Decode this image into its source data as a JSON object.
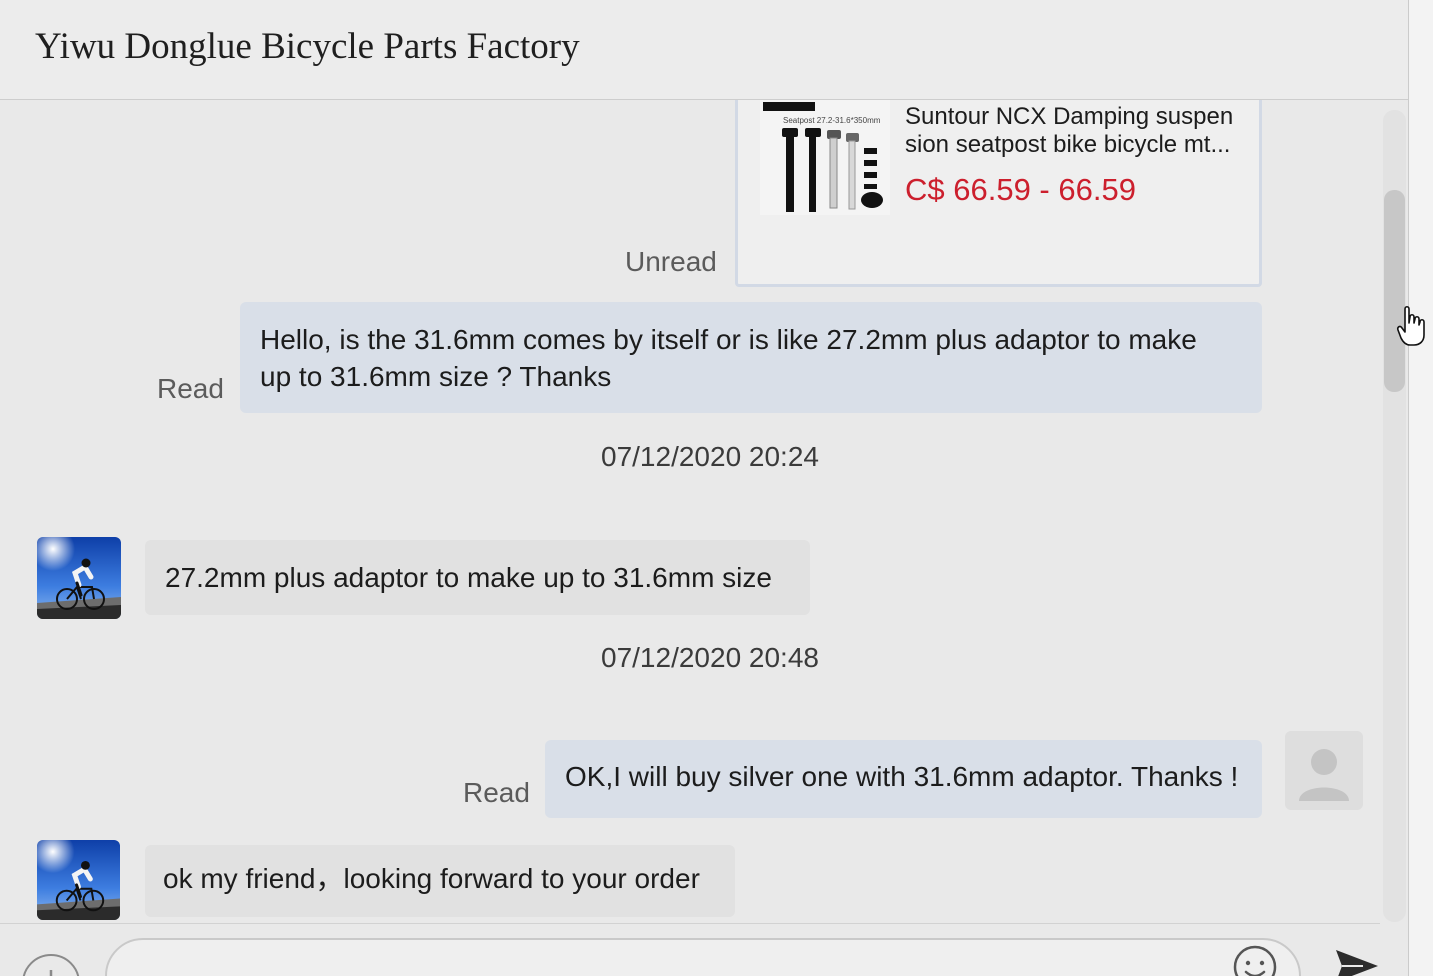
{
  "header": {
    "title": "Yiwu Donglue Bicycle Parts Factory"
  },
  "product_card": {
    "image_caption": "Seatpost 27.2-31.6*350mm",
    "title_lines": [
      "Suntour NCX Damping suspen",
      "sion seatpost bike bicycle mt..."
    ],
    "price": "C$ 66.59 - 66.59",
    "read_status": "Unread"
  },
  "messages": [
    {
      "direction": "outgoing",
      "text": "Hello, is the 31.6mm comes by itself or is like 27.2mm plus adaptor to make up to 31.6mm size ? Thanks",
      "read_status": "Read"
    },
    {
      "type": "timestamp",
      "text": "07/12/2020 20:24"
    },
    {
      "direction": "incoming",
      "text": "27.2mm plus adaptor to make up to 31.6mm size"
    },
    {
      "type": "timestamp",
      "text": "07/12/2020 20:48"
    },
    {
      "direction": "outgoing",
      "text": "OK,I will buy silver one with 31.6mm adaptor. Thanks !",
      "read_status": "Read"
    },
    {
      "direction": "incoming",
      "text": "ok my friend，looking forward to your order"
    }
  ],
  "icons": {
    "composer_left": "plus-icon",
    "composer_emoji": "emoji-icon",
    "composer_send": "send-icon",
    "cursor": "hand-pointer-icon",
    "my_avatar": "default-user-icon"
  },
  "colors": {
    "outgoing_bubble": "#d9dfe8",
    "incoming_bubble": "#e1e1e1",
    "price": "#cc1f2d",
    "background": "#e9e9e9"
  }
}
